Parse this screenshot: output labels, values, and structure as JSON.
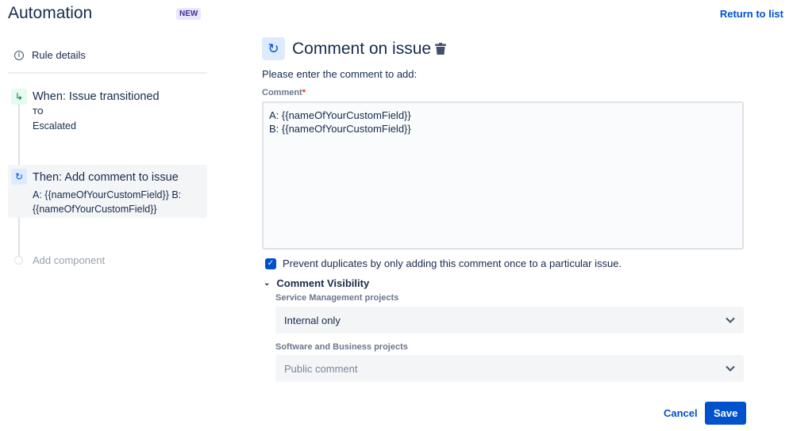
{
  "header": {
    "title": "Automation",
    "badge": "NEW",
    "return_link": "Return to list"
  },
  "sidebar": {
    "rule_details": "Rule details",
    "trigger": {
      "title": "When: Issue transitioned",
      "label": "TO",
      "value": "Escalated"
    },
    "action": {
      "title": "Then: Add comment to issue",
      "summary": "A: {{nameOfYourCustomField}} B: {{nameOfYourCustomField}}"
    },
    "add_component": "Add component"
  },
  "main": {
    "title": "Comment on issue",
    "instructions": "Please enter the comment to add:",
    "comment_label": "Comment",
    "required_marker": "*",
    "comment_value": "A: {{nameOfYourCustomField}}\nB: {{nameOfYourCustomField}}",
    "prevent_duplicates": {
      "label": "Prevent duplicates by only adding this comment once to a particular issue.",
      "checked": true
    },
    "visibility": {
      "title": "Comment Visibility",
      "service_label": "Service Management projects",
      "service_value": "Internal only",
      "software_label": "Software and Business projects",
      "software_placeholder": "Public comment"
    },
    "cancel": "Cancel",
    "save": "Save"
  },
  "colors": {
    "primary": "#0052cc",
    "text": "#172b4d"
  }
}
